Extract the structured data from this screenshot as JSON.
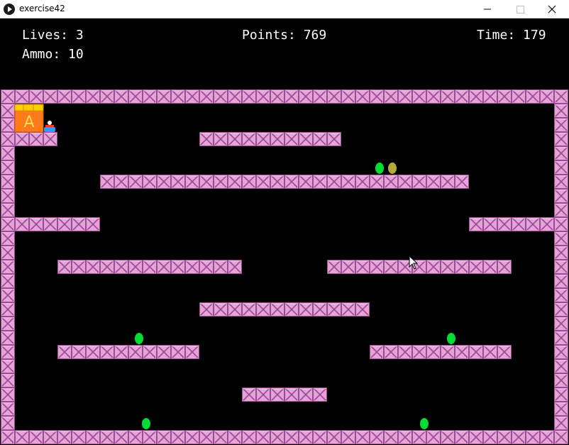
{
  "window": {
    "title": "exercise42",
    "minimize_icon": "minimize-icon",
    "maximize_icon": "maximize-icon",
    "close_icon": "close-icon"
  },
  "hud": {
    "lives_label": "Lives: 3",
    "ammo_label": "Ammo: 10",
    "points_label": "Points: 769",
    "time_label": "Time: 179"
  },
  "game": {
    "lives": 3,
    "ammo": 10,
    "points": 769,
    "time": 179,
    "crate_letter": "A"
  },
  "colors": {
    "brick_fill": "#e6a3d8",
    "brick_stroke": "#9c4a94",
    "background": "#000000",
    "enemy_green": "#00dd33",
    "enemy_olive": "#b8a836",
    "crate_orange": "#ff7a1a",
    "crate_top": "#ffcc00",
    "player_blue": "#3399ff"
  }
}
